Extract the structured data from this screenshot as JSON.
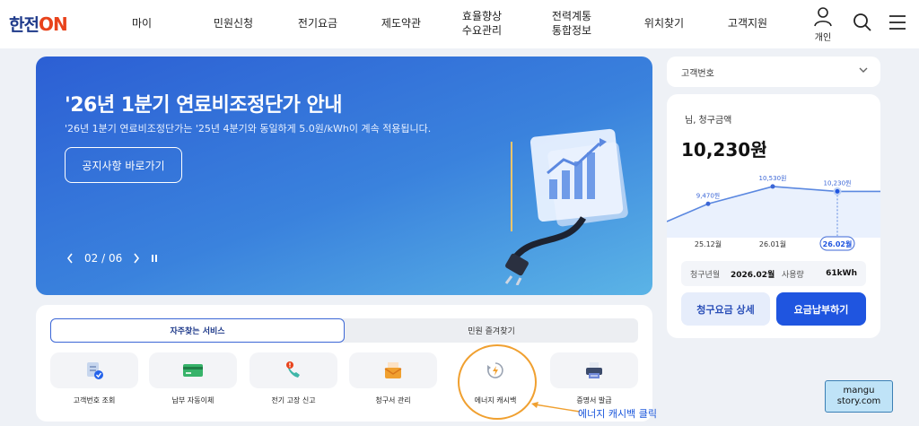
{
  "header": {
    "logo_text": "한전",
    "logo_on": "ON",
    "nav": [
      "마이",
      "민원신청",
      "전기요금",
      "제도약관",
      "효율향상\n수요관리",
      "전력계통\n통합정보",
      "위치찾기",
      "고객지원"
    ],
    "user_label": "개인"
  },
  "banner": {
    "title": "'26년 1분기 연료비조정단가 안내",
    "subtitle": "'26년 1분기 연료비조정단가는 '25년 4분기와 동일하게 5.0원/kWh이 계속 적용됩니다.",
    "button_label": "공지사항 바로가기",
    "pager": "02 / 06"
  },
  "customer": {
    "select_label": "고객번호"
  },
  "bill": {
    "name_suffix": "님, 청구금액",
    "amount": "10,230원",
    "chart_data": {
      "type": "line",
      "categories": [
        "25.12월",
        "26.01월",
        "26.02월"
      ],
      "values": [
        9470,
        10530,
        10230
      ],
      "data_labels": [
        "9,470원",
        "10,530원",
        "10,230원"
      ],
      "selected": "26.02월"
    },
    "info": {
      "month_label": "청구년월",
      "month_value": "2026.02월",
      "usage_label": "사용량",
      "usage_value": "61kWh"
    },
    "detail_button": "청구요금 상세",
    "pay_button": "요금납부하기"
  },
  "services": {
    "tab_frequent": "자주찾는 서비스",
    "tab_favorites": "민원 즐겨찾기",
    "items": [
      {
        "label": "고객번호 조회",
        "icon": "document-check-icon"
      },
      {
        "label": "납부 자동이체",
        "icon": "card-icon"
      },
      {
        "label": "전기 고장 신고",
        "icon": "phone-alert-icon"
      },
      {
        "label": "청구서 관리",
        "icon": "envelope-icon"
      },
      {
        "label": "에너지 캐시백",
        "icon": "energy-cashback-icon"
      },
      {
        "label": "증명서 발급",
        "icon": "printer-icon"
      }
    ]
  },
  "annotation": {
    "text": "에너지 캐시백 클릭",
    "watermark_line1": "mangu",
    "watermark_line2": "story.com"
  },
  "colors": {
    "brand_blue": "#1f55e0",
    "logo_orange": "#e8431c",
    "highlight": "#f0a030"
  }
}
